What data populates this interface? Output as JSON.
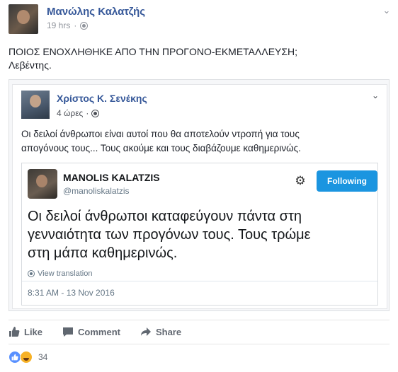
{
  "post": {
    "author": "Μανώλης Καλατζής",
    "time": "19 hrs",
    "separator": "·",
    "text_line1": "ΠΟΙΟΣ ΕΝΟΧΛΗΘΗΚΕ ΑΠΟ ΤΗΝ ΠΡΟΓΟΝΟ-ΕΚΜΕΤΑΛΛΕΥΣΗ;",
    "text_line2": "Λεβέντης.",
    "menu_icon": "chevron-down-icon",
    "audience_icon": "globe-icon"
  },
  "shared": {
    "author": "Χρίστος Κ. Σενέκης",
    "time": "4 ώρες",
    "separator": "·",
    "text_line1": "Οι δειλοί άνθρωποι είναι αυτοί που θα αποτελούν ντροπή για τους",
    "text_line2": "απογόνους τους... Τους ακούμε και τους διαβάζουμε καθημερινώς."
  },
  "tweet": {
    "name": "MANOLIS KALATZIS",
    "handle": "@manoliskalatzis",
    "follow_label": "Following",
    "body_line1": "Οι δειλοί άνθρωποι καταφεύγουν πάντα στη",
    "body_line2": "γενναιότητα των προγόνων τους. Τους τρώμε",
    "body_line3": "στη μάπα καθημερινώς.",
    "translate_label": "View translation",
    "timestamp": "8:31 AM - 13 Nov 2016",
    "accent_color": "#1b95e0"
  },
  "actions": {
    "like": "Like",
    "comment": "Comment",
    "share": "Share"
  },
  "reactions": {
    "count": "34",
    "types": [
      "like",
      "haha"
    ],
    "like_color": "#5890ff",
    "haha_color": "#f7b125"
  },
  "colors": {
    "link": "#365899",
    "muted": "#90949c",
    "action_text": "#616770"
  }
}
